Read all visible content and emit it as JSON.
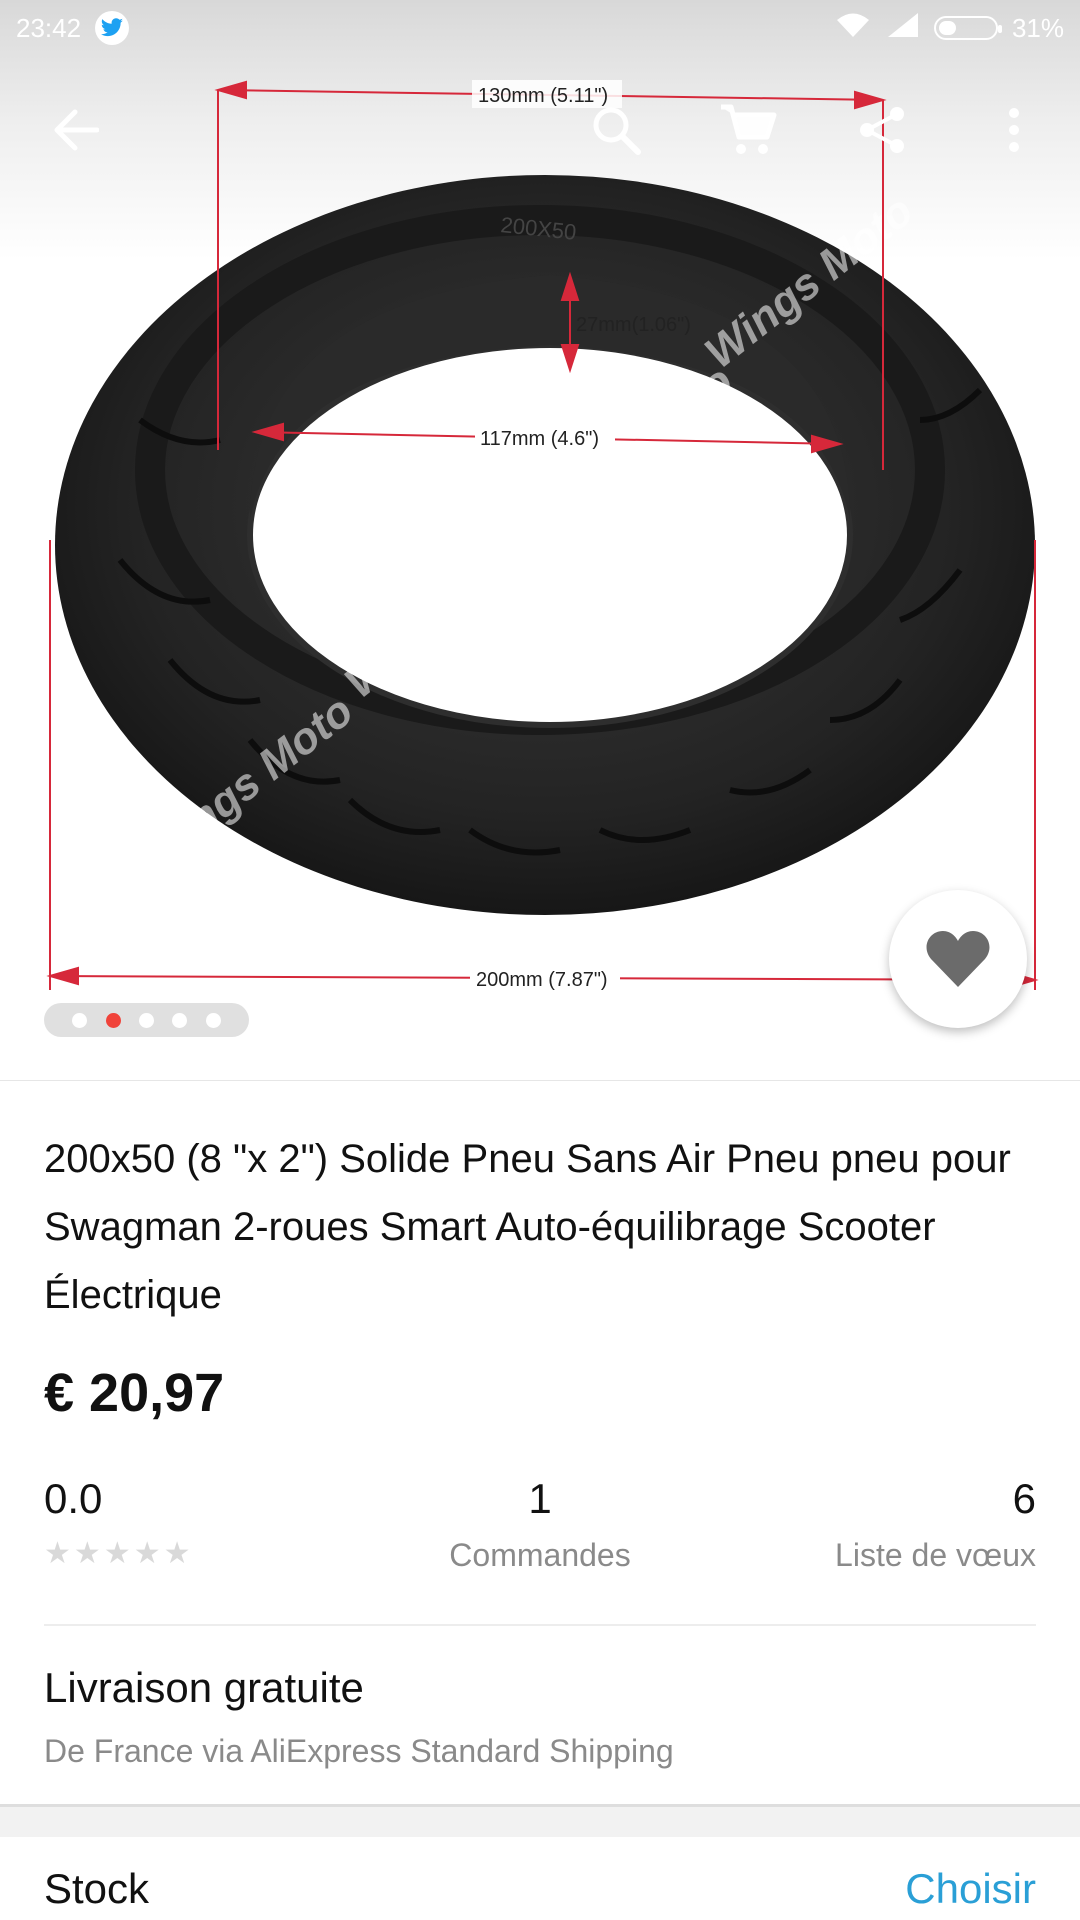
{
  "status_bar": {
    "time": "23:42",
    "battery_percent": "31%",
    "battery_level": 0.31,
    "notification_icon": "twitter-icon"
  },
  "toolbar": {
    "back_icon": "back-arrow-icon",
    "search_icon": "search-icon",
    "cart_icon": "cart-icon",
    "share_icon": "share-icon",
    "more_icon": "more-vert-icon"
  },
  "product_image": {
    "watermark": "Wings Moto",
    "tire_marking": "200X50",
    "dimensions": {
      "top_width": "130mm (5.11\")",
      "height": "27mm(1.06\")",
      "inner_width": "117mm (4.6\")",
      "outer_diameter": "200mm (7.87\")"
    },
    "carousel": {
      "count": 5,
      "active_index": 1
    }
  },
  "product": {
    "title": "200x50 (8 \"x 2\") Solide Pneu Sans Air Pneu pneu pour Swagman 2-roues Smart Auto-équilibrage Scooter Électrique",
    "price": "€ 20,97"
  },
  "stats": {
    "rating": "0.0",
    "stars_filled": 0,
    "orders_count": "1",
    "orders_label": "Commandes",
    "wishlist_count": "6",
    "wishlist_label": "Liste de vœux"
  },
  "shipping": {
    "title": "Livraison gratuite",
    "subtitle": "De France via AliExpress Standard Shipping"
  },
  "next_row": {
    "left_label": "Stock",
    "right_label": "Choisir"
  },
  "colors": {
    "accent_red": "#f0433a",
    "link_blue": "#2a9fd6",
    "secondary_text": "#8a8a8a"
  }
}
